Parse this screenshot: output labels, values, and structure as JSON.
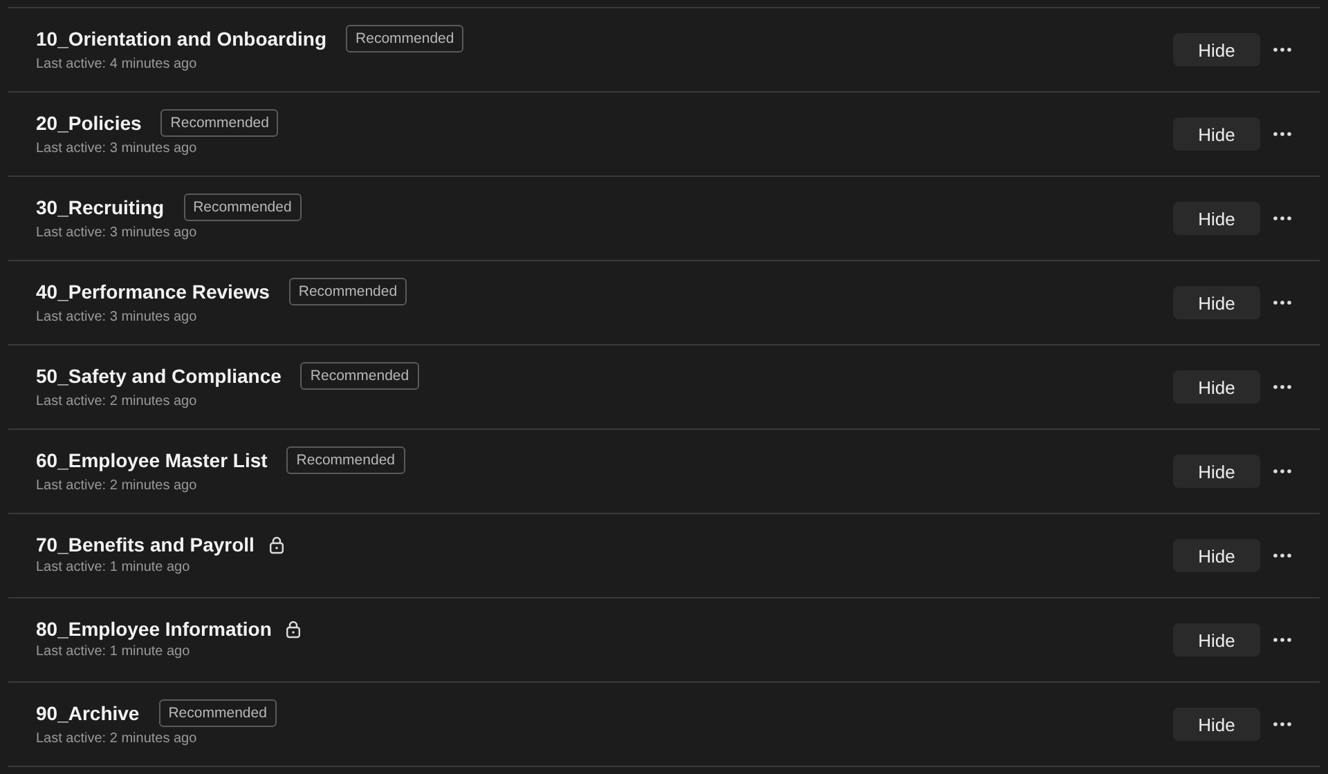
{
  "channels": [
    {
      "name": "10_Orientation and Onboarding",
      "kind": "tagged",
      "tag": "Recommended",
      "activity": "Last active: 4 minutes ago",
      "action": "Hide"
    },
    {
      "name": "20_Policies",
      "kind": "tagged",
      "tag": "Recommended",
      "activity": "Last active: 3 minutes ago",
      "action": "Hide"
    },
    {
      "name": "30_Recruiting",
      "kind": "tagged",
      "tag": "Recommended",
      "activity": "Last active: 3 minutes ago",
      "action": "Hide"
    },
    {
      "name": "40_Performance Reviews",
      "kind": "tagged",
      "tag": "Recommended",
      "activity": "Last active: 3 minutes ago",
      "action": "Hide"
    },
    {
      "name": "50_Safety and Compliance",
      "kind": "tagged",
      "tag": "Recommended",
      "activity": "Last active: 2 minutes ago",
      "action": "Hide"
    },
    {
      "name": "60_Employee Master List",
      "kind": "tagged",
      "tag": "Recommended",
      "activity": "Last active: 2 minutes ago",
      "action": "Hide"
    },
    {
      "name": "70_Benefits and Payroll",
      "kind": "locked",
      "activity": "Last active: 1 minute ago",
      "action": "Hide"
    },
    {
      "name": "80_Employee Information",
      "kind": "locked",
      "activity": "Last active: 1 minute ago",
      "action": "Hide"
    },
    {
      "name": "90_Archive",
      "kind": "tagged",
      "tag": "Recommended",
      "activity": "Last active: 2 minutes ago",
      "action": "Hide"
    }
  ]
}
